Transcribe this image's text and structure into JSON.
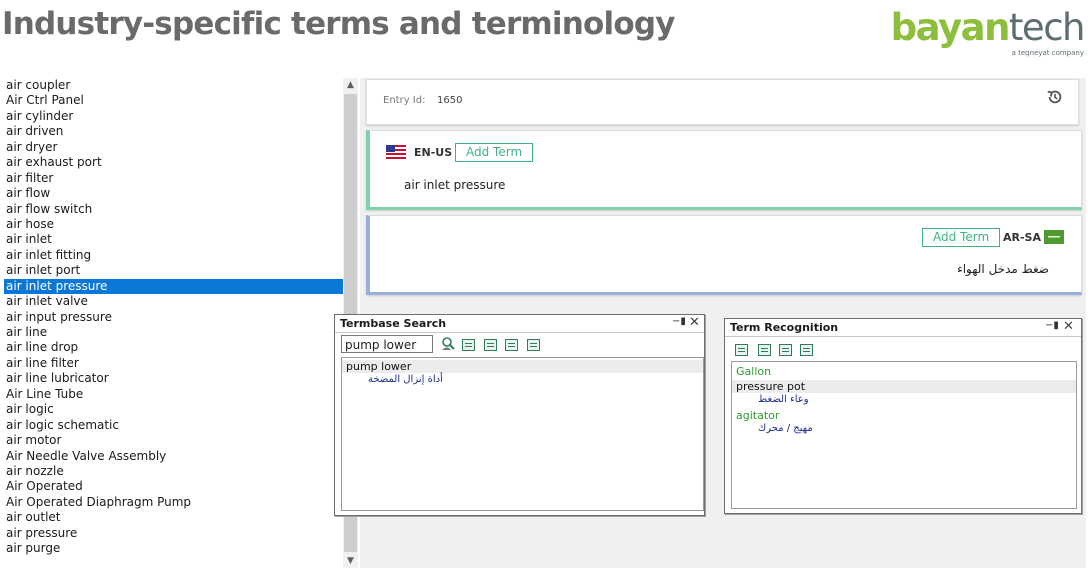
{
  "header": {
    "title": "Industry-specific terms and terminology",
    "logo_bayan": "bayan",
    "logo_tech": "tech",
    "logo_sub": "a teqneyat company"
  },
  "term_list": {
    "items": [
      "air coupler",
      "Air Ctrl Panel",
      "air cylinder",
      "air driven",
      "air dryer",
      "air exhaust port",
      "air filter",
      "air flow",
      "air flow switch",
      "air hose",
      "air inlet",
      "air inlet fitting",
      "air inlet port",
      "air inlet pressure",
      "air inlet valve",
      "air input pressure",
      "air line",
      "air line drop",
      "air line filter",
      "air line lubricator",
      "Air Line Tube",
      "air logic",
      "air logic schematic",
      "air motor",
      "Air Needle Valve Assembly",
      "air nozzle",
      "Air Operated",
      "Air Operated Diaphragm Pump",
      "air outlet",
      "air pressure",
      "air purge"
    ],
    "selected": "air inlet pressure"
  },
  "entry": {
    "id_label": "Entry Id:",
    "id_value": "1650"
  },
  "source_term": {
    "lang": "EN-US",
    "add_label": "Add Term",
    "term": "air inlet pressure"
  },
  "target_term": {
    "lang": "AR-SA",
    "add_label": "Add Term",
    "term": "ضغط مدخل الهواء"
  },
  "termbase_search": {
    "title": "Termbase Search",
    "query": "pump lower",
    "results": [
      {
        "source": "pump lower",
        "target": "أداة إنزال المضخة"
      }
    ]
  },
  "term_recognition": {
    "title": "Term Recognition",
    "items": [
      {
        "source": "Gallon",
        "target": ""
      },
      {
        "source": "pressure pot",
        "target": "وعاء الضغط"
      },
      {
        "source": "agitator",
        "target": "مهيج / محرك"
      }
    ]
  },
  "colors": {
    "accent_green": "#8dbf3c",
    "selection_blue": "#0b78d7",
    "en_border": "#7fd1a8",
    "ar_border": "#99aedb"
  }
}
